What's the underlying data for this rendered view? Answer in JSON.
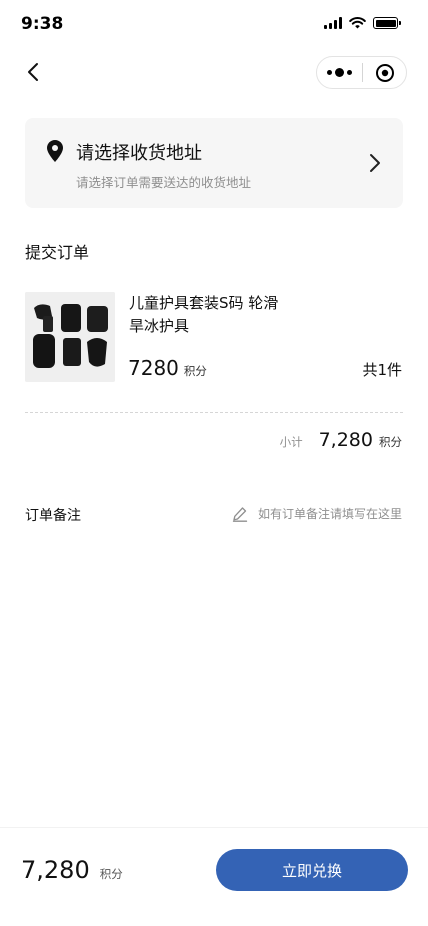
{
  "status_bar": {
    "time": "9:38"
  },
  "address": {
    "title": "请选择收货地址",
    "subtitle": "请选择订单需要送达的收货地址"
  },
  "order": {
    "section_title": "提交订单",
    "product": {
      "name": "儿童护具套装S码 轮滑旱冰护具",
      "points": "7280",
      "points_unit": "积分",
      "quantity": "共1件"
    },
    "subtotal": {
      "label": "小计",
      "value": "7,280",
      "unit": "积分"
    }
  },
  "remark": {
    "label": "订单备注",
    "placeholder": "如有订单备注请填写在这里"
  },
  "bottom_bar": {
    "total": "7,280",
    "total_unit": "积分",
    "submit_label": "立即兑换"
  },
  "colors": {
    "accent": "#3463b5",
    "card_bg": "#f6f6f6",
    "muted_text": "#8f8f8f"
  }
}
